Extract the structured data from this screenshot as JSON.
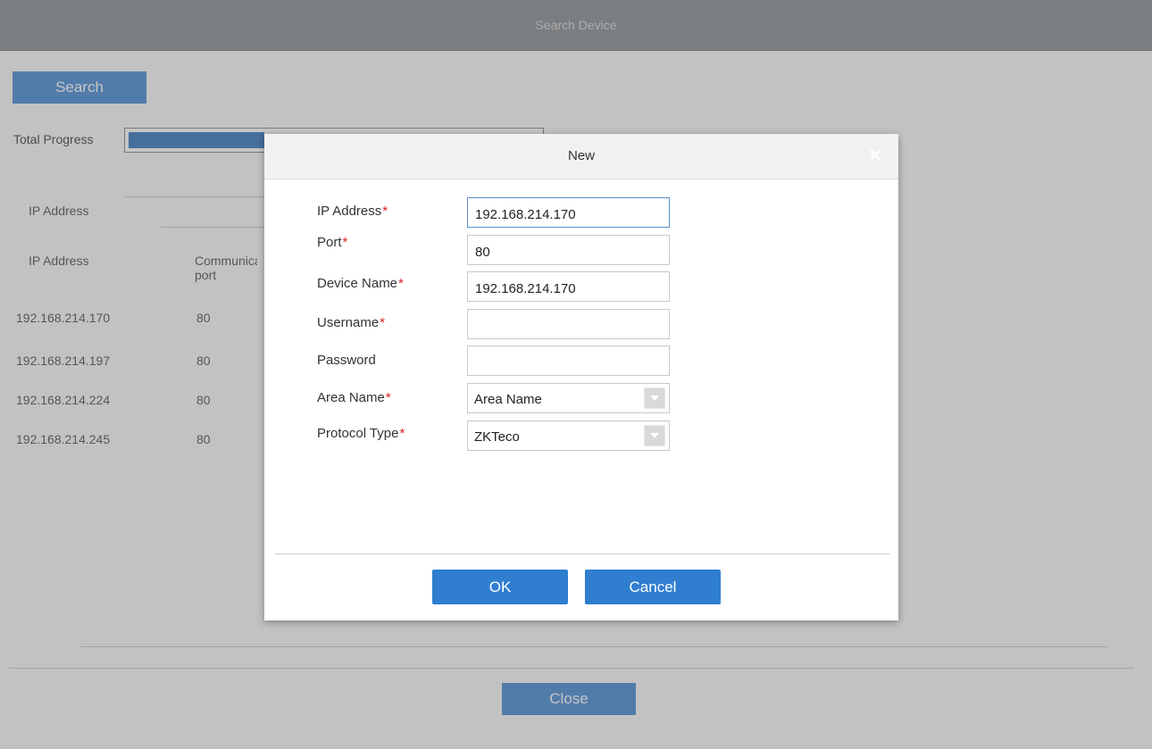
{
  "background_window": {
    "title": "Search Device",
    "search_button": "Search",
    "total_progress_label": "Total Progress",
    "total_progress_fraction": 0.33,
    "filter_ip_label": "IP Address",
    "columns": {
      "ip": "IP Address",
      "port": "Communication port"
    },
    "rows": [
      {
        "ip": "192.168.214.170",
        "port": "80"
      },
      {
        "ip": "192.168.214.197",
        "port": "80"
      },
      {
        "ip": "192.168.214.224",
        "port": "80"
      },
      {
        "ip": "192.168.214.245",
        "port": "80"
      }
    ],
    "close_button": "Close"
  },
  "dialog": {
    "title": "New",
    "close_icon": "close-icon",
    "fields": {
      "ip_address": {
        "label": "IP Address",
        "value": "192.168.214.170",
        "required": true
      },
      "port": {
        "label": "Port",
        "value": "80",
        "required": true
      },
      "device_name": {
        "label": "Device Name",
        "value": "192.168.214.170",
        "required": true
      },
      "username": {
        "label": "Username",
        "value": "",
        "required": true
      },
      "password": {
        "label": "Password",
        "value": "",
        "required": false
      },
      "area_name": {
        "label": "Area Name",
        "value": "Area Name",
        "required": true
      },
      "protocol_type": {
        "label": "Protocol Type",
        "value": "ZKTeco",
        "required": true
      }
    },
    "required_mark": "*",
    "ok_button": "OK",
    "cancel_button": "Cancel"
  },
  "colors": {
    "primary_button": "#2f7ed0",
    "required_mark": "#e02020",
    "header_bg": "#f1f1f1"
  }
}
